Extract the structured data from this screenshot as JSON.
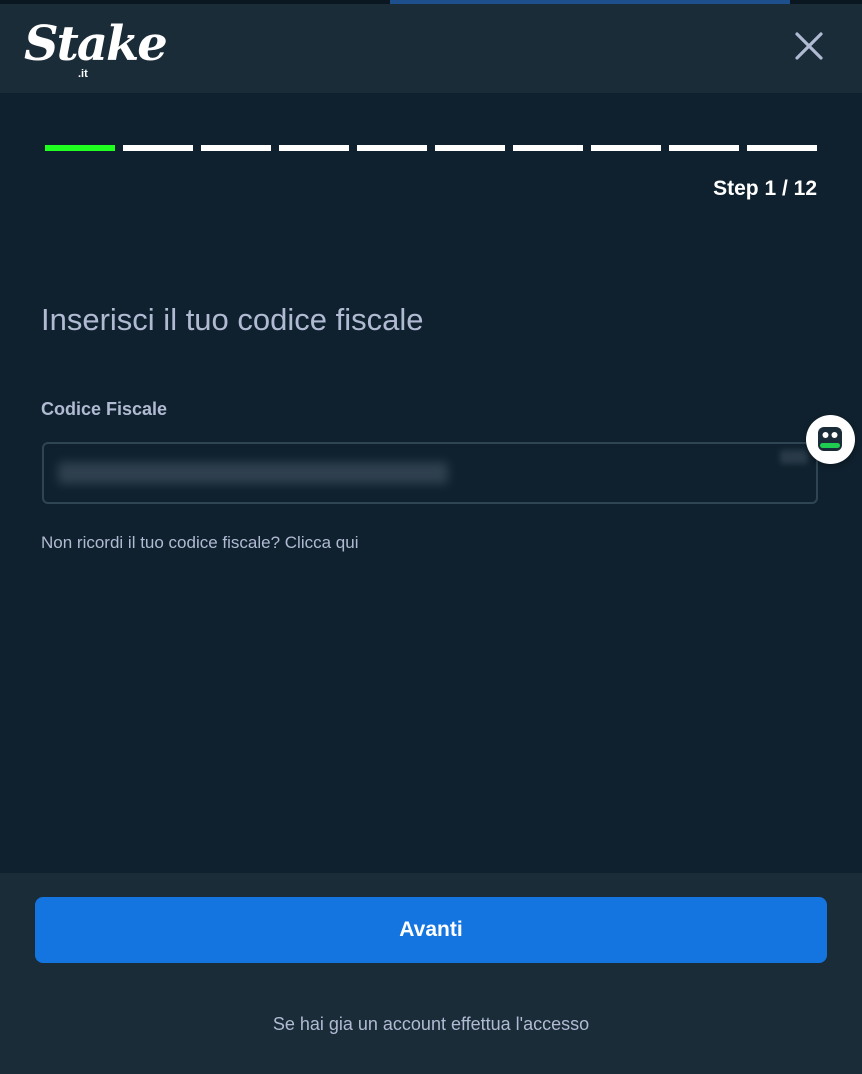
{
  "header": {
    "logo_word": "Stake",
    "logo_tld": ".it",
    "close_icon": "close-icon"
  },
  "progress": {
    "current_step": 1,
    "total_steps": 12,
    "visible_segments": 10,
    "active_color": "#1fff20",
    "inactive_color": "#ffffff",
    "step_label": "Step 1 / 12"
  },
  "form": {
    "title": "Inserisci il tuo codice fiscale",
    "field_label": "Codice Fiscale",
    "field_value": "",
    "helper_text": "Non ricordi il tuo codice fiscale? Clicca qui",
    "helper_icon": "chat-bot-icon"
  },
  "footer": {
    "primary_button": "Avanti",
    "login_text": "Se hai gia un account effettua l'accesso"
  },
  "colors": {
    "background": "#0f212e",
    "panel": "#1a2c38",
    "primary": "#1475e1",
    "muted_text": "#b1bad3"
  }
}
